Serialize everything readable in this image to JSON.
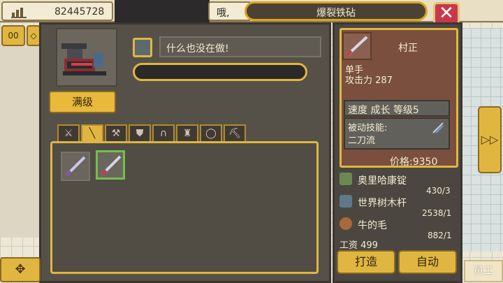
{
  "top": {
    "money": "82445728",
    "message_prefix": "哦,",
    "title": "爆裂铁砧",
    "close_label": "✕"
  },
  "left_buttons": {
    "pause_label": "00",
    "diamond_label": "◇",
    "compass_label": "✥"
  },
  "anvil": {
    "max_level_label": "满级",
    "status_text": "什么也没在做!",
    "progress_fraction": 0.0
  },
  "tabs": [
    {
      "icon": "sword-icon",
      "glyph": "⚔",
      "active": false
    },
    {
      "icon": "spear-icon",
      "glyph": "╲",
      "active": true
    },
    {
      "icon": "axe-icon",
      "glyph": "⚒",
      "active": false
    },
    {
      "icon": "shield-icon",
      "glyph": "⛊",
      "active": false
    },
    {
      "icon": "helmet-icon",
      "glyph": "∩",
      "active": false
    },
    {
      "icon": "armor-icon",
      "glyph": "♜",
      "active": false
    },
    {
      "icon": "ring-icon",
      "glyph": "◯",
      "active": false
    },
    {
      "icon": "pickaxe-icon",
      "glyph": "⛏",
      "active": false
    }
  ],
  "item": {
    "name": "村正",
    "hand": "单手",
    "attack": "攻击力 287",
    "stats": "速度 成长 等级5",
    "passive_label": "被动技能:",
    "passive_value": "二刀流",
    "price": "价格:9350"
  },
  "materials": [
    {
      "name": "奥里哈康锭",
      "qty": "430/3",
      "color": "#6a8a52"
    },
    {
      "name": "世界树木杆",
      "qty": "2538/1",
      "color": "#5e7a8a"
    },
    {
      "name": "牛的毛",
      "qty": "882/1",
      "color": "#a86a3a"
    }
  ],
  "wage": "工资 499",
  "actions": {
    "craft_label": "打造",
    "auto_label": "自动"
  },
  "next_label": "▷▷",
  "staff_label": "员工",
  "colors": {
    "accent": "#e0b640",
    "panel": "#555149",
    "card": "#7a4f3d",
    "close": "#c9384a"
  }
}
